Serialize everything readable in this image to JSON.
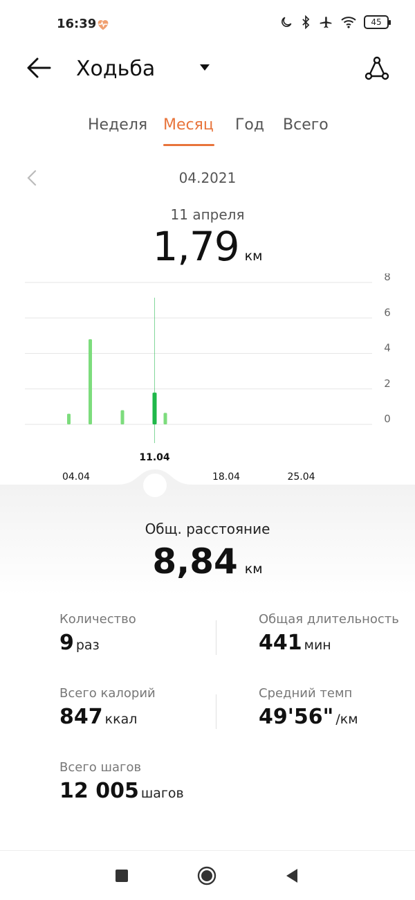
{
  "status_bar": {
    "time": "16:39",
    "battery": "45",
    "icons": [
      "heart-rate-icon",
      "moon-icon",
      "bluetooth-icon",
      "airplane-icon",
      "wifi-icon",
      "battery-icon"
    ]
  },
  "header": {
    "title": "Ходьба",
    "back_icon": "arrow-left-icon",
    "dropdown_icon": "caret-down-icon",
    "route_icon": "route-icon"
  },
  "tabs": [
    {
      "label": "Неделя",
      "active": false
    },
    {
      "label": "Месяц",
      "active": true
    },
    {
      "label": "Год",
      "active": false
    },
    {
      "label": "Всего",
      "active": false
    }
  ],
  "period": {
    "label": "04.2021",
    "prev_icon": "chevron-left-icon"
  },
  "selected": {
    "date": "11 апреля",
    "value": "1,79",
    "unit": "км"
  },
  "chart_data": {
    "type": "bar",
    "x_tick_labels": [
      "04.04",
      "11.04",
      "18.04",
      "25.04"
    ],
    "selected_label": "11.04",
    "y_ticks": [
      "8",
      "6",
      "4",
      "2",
      "0"
    ],
    "ylim": [
      0,
      8
    ],
    "days": [
      1,
      2,
      3,
      4,
      5,
      6,
      7,
      8,
      9,
      10,
      11,
      12,
      13,
      14,
      15,
      16,
      17,
      18,
      19,
      20,
      21,
      22,
      23,
      24,
      25,
      26,
      27,
      28,
      29,
      30
    ],
    "values": [
      0,
      0,
      0.6,
      0,
      4.8,
      0,
      0,
      0.8,
      0,
      0,
      1.79,
      0.65,
      0,
      0,
      0,
      0,
      0,
      0,
      0,
      0,
      0,
      0,
      0,
      0,
      0,
      0,
      0,
      0,
      0,
      0
    ],
    "selected_day": 11,
    "colors": {
      "bar": "#7ddc7d",
      "selected": "#1fb84a",
      "grid": "#e6e6e6"
    }
  },
  "summary": {
    "total_label": "Общ. расстояние",
    "total_value": "8,84",
    "total_unit": "км",
    "stats": [
      {
        "label": "Количество",
        "value": "9",
        "unit": "раз"
      },
      {
        "label": "Общая длительность",
        "value": "441",
        "unit": "мин"
      },
      {
        "label": "Всего калорий",
        "value": "847",
        "unit": "ккал"
      },
      {
        "label": "Средний темп",
        "value": "49'56\"",
        "unit": "/км"
      },
      {
        "label": "Всего шагов",
        "value": "12 005",
        "unit": "шагов"
      }
    ]
  },
  "nav": {
    "icons": [
      "square-recents-icon",
      "circle-home-icon",
      "triangle-back-icon"
    ]
  },
  "colors": {
    "accent": "#e8743b",
    "bar": "#7ddc7d",
    "bar_selected": "#1fb84a"
  }
}
